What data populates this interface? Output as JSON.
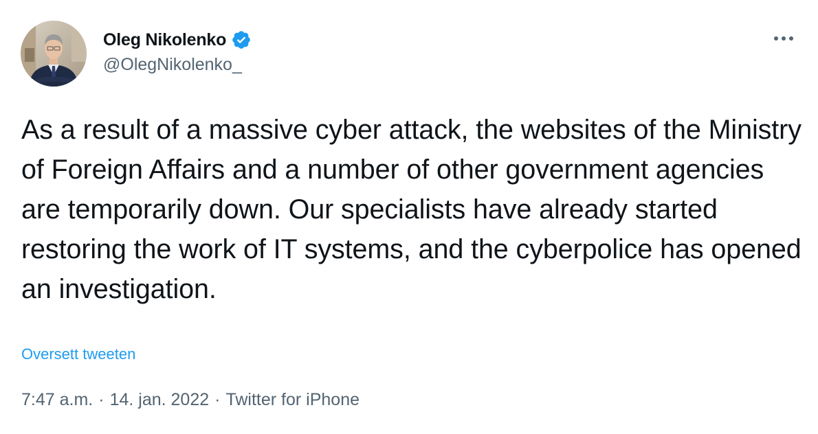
{
  "author": {
    "display_name": "Oleg Nikolenko",
    "handle": "@OlegNikolenko_",
    "verified": true,
    "accent_color": "#1d9bf0"
  },
  "tweet": {
    "text": "As a result of a massive cyber attack, the websites of the Ministry of Foreign Affairs and a number of other government agencies are temporarily down. Our specialists have already started restoring the work of IT systems, and the cyberpolice has opened an investigation.",
    "translate_label": "Oversett tweeten"
  },
  "meta": {
    "time": "7:47 a.m.",
    "separator": "·",
    "date": "14. jan. 2022",
    "source": "Twitter for iPhone"
  },
  "icons": {
    "more": "more-options-icon",
    "verified": "verified-badge-icon"
  }
}
